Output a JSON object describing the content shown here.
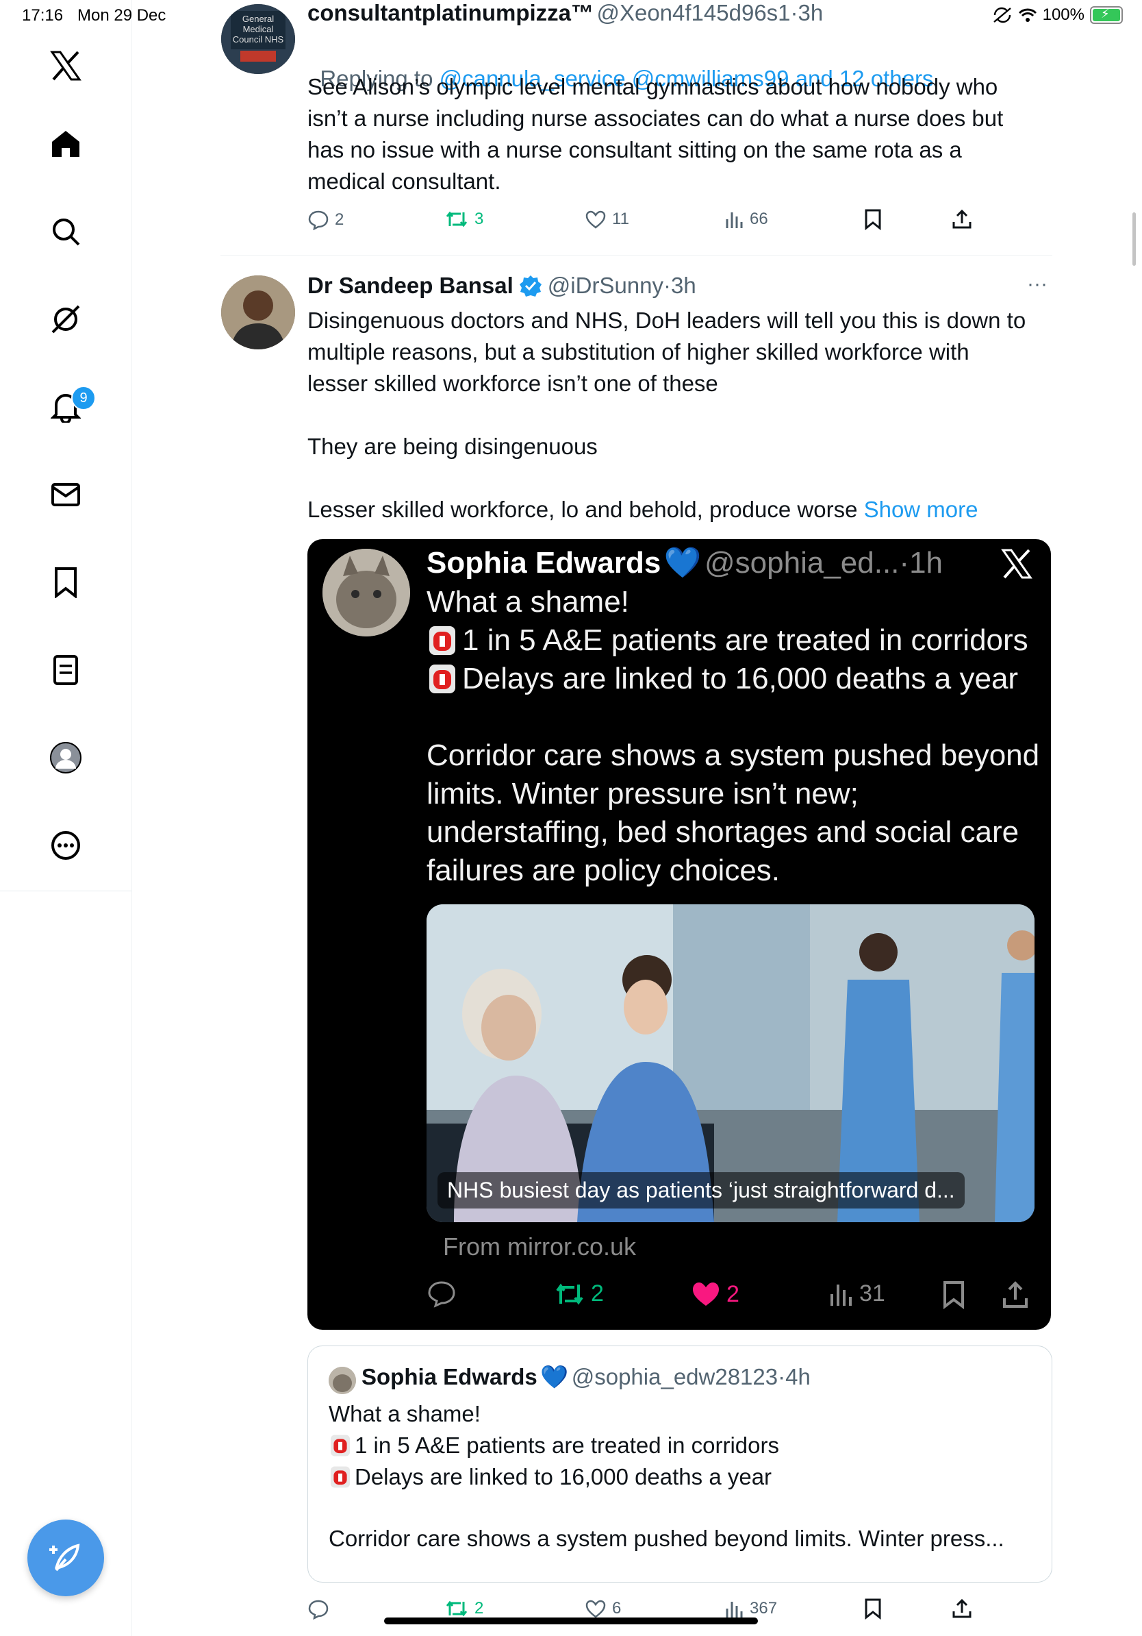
{
  "status_bar": {
    "time": "17:16",
    "date": "Mon 29 Dec",
    "battery": "100%"
  },
  "sidebar": {
    "notification_count": "9"
  },
  "tweet1": {
    "display_name": "consultantplatinumpizza™",
    "handle": "@Xeon4f145d96s1",
    "time": "3h",
    "replying_prefix": "Replying to ",
    "replying_to": "@cannula_service @cmwilliams99 and 12 others",
    "avatar_text": "General Medical Council NHS",
    "text": "See Alison’s olympic level mental gymnastics about how nobody who\nisn’t a nurse including nurse associates can do what a nurse does but\nhas no issue with a nurse consultant sitting on the same rota as a\nmedical consultant.",
    "replies": "2",
    "reposts": "3",
    "likes": "11",
    "views": "66"
  },
  "tweet2": {
    "display_name": "Dr Sandeep Bansal",
    "handle": "@iDrSunny",
    "time": "3h",
    "more": "···",
    "text": "Disingenuous doctors and NHS, DoH leaders will tell you this is down to\nmultiple reasons, but a substitution of higher skilled workforce with\nlesser skilled workforce isn’t one of these\n\nThey are being disingenuous\n\nLesser skilled workforce, lo and behold, produce worse ",
    "show_more": "Show more",
    "replies": "",
    "reposts": "2",
    "likes": "6",
    "views": "367"
  },
  "embedded_screenshot": {
    "display_name": "Sophia Edwards",
    "heart_emoji": "💙",
    "handle": "@sophia_ed...",
    "time": "1h",
    "text_line1": "What a shame!",
    "bullet1": "1 in 5 A&E patients are treated in corridors",
    "bullet2": "Delays are linked to 16,000 deaths a year",
    "paragraph": "Corridor care shows a system pushed beyond\nlimits. Winter pressure isn’t new;\nunderstaffing, bed shortages and social care\nfailures are policy choices.",
    "link_caption": "NHS busiest day as patients ‘just straightforward d...",
    "link_source": "From mirror.co.uk",
    "reposts": "2",
    "likes": "2",
    "views": "31"
  },
  "quote": {
    "display_name": "Sophia Edwards",
    "heart_emoji": "💙",
    "handle": "@sophia_edw28123",
    "time": "4h",
    "text_line1": "What a shame!",
    "bullet1": "1 in 5 A&E patients are treated in corridors",
    "bullet2": "Delays are linked to 16,000 deaths a year",
    "paragraph": "Corridor care shows a system pushed beyond limits. Winter press..."
  },
  "separator": "·",
  "colors": {
    "accent": "#1d9bf0",
    "repost": "#00ba7c",
    "like_active": "#f91880",
    "fab": "#4a99e9"
  }
}
